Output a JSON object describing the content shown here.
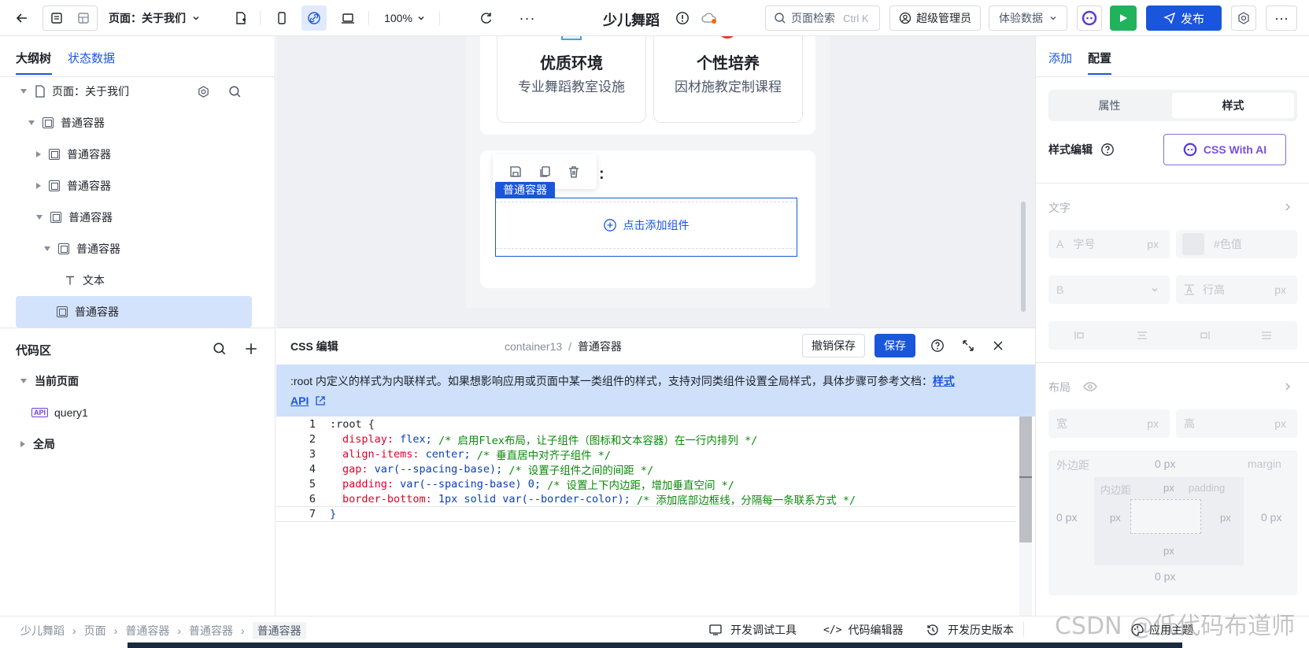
{
  "topbar": {
    "page_selector": "页面：关于我们",
    "zoom": "100%",
    "app_title": "少儿舞蹈",
    "search_placeholder": "页面检索",
    "search_shortcut": "Ctrl K",
    "admin_label": "超级管理员",
    "data_label": "体验数据",
    "publish_label": "发布"
  },
  "left": {
    "tab_outline": "大纲树",
    "tab_state": "状态数据",
    "tree": [
      "页面：关于我们",
      "普通容器",
      "普通容器",
      "普通容器",
      "普通容器",
      "普通容器",
      "文本",
      "普通容器"
    ],
    "code_title": "代码区",
    "current_page": "当前页面",
    "query_label": "query1",
    "api_tag": "API",
    "global": "全局"
  },
  "canvas": {
    "card1_title": "优质环境",
    "card1_desc": "专业舞蹈教室设施",
    "card2_title": "个性培养",
    "card2_desc": "因材施教定制课程",
    "selected_tag": "普通容器",
    "add_component": "点击添加组件"
  },
  "css_editor": {
    "title": "CSS 编辑",
    "path_id": "container13",
    "path_sep": "/",
    "path_name": "普通容器",
    "undo_save": "撤销保存",
    "save": "保存",
    "notice": ":root 内定义的样式为内联样式。如果想影响应用或页面中某一类组件的样式，支持对同类组件设置全局样式，具体步骤可参考文档：",
    "notice_link": "样式",
    "notice_link2": "API",
    "lines": [
      {
        "n": "1",
        "sel": ":root {",
        "prop": "",
        "val": "",
        "com": ""
      },
      {
        "n": "2",
        "sel": "",
        "prop": "display:",
        "val": " flex;",
        "com": " /* 启用Flex布局，让子组件（图标和文本容器）在一行内排列 */"
      },
      {
        "n": "3",
        "sel": "",
        "prop": "align-items:",
        "val": " center;",
        "com": " /* 垂直居中对齐子组件 */"
      },
      {
        "n": "4",
        "sel": "",
        "prop": "gap:",
        "val": " var(--spacing-base);",
        "com": " /* 设置子组件之间的间距 */"
      },
      {
        "n": "5",
        "sel": "",
        "prop": "padding:",
        "val": " var(--spacing-base) 0;",
        "com": " /* 设置上下内边距，增加垂直空间 */"
      },
      {
        "n": "6",
        "sel": "",
        "prop": "border-bottom:",
        "val": " 1px solid var(--border-color);",
        "com": " /* 添加底部边框线，分隔每一条联系方式 */"
      },
      {
        "n": "7",
        "sel": "}",
        "prop": "",
        "val": "",
        "com": ""
      }
    ]
  },
  "right": {
    "tab_add": "添加",
    "tab_config": "配置",
    "seg_props": "属性",
    "seg_style": "样式",
    "style_edit": "样式编辑",
    "css_ai": "CSS With AI",
    "section_text": "文字",
    "font_size_ph": "字号",
    "px": "px",
    "color_ph": "#色值",
    "line_height_ph": "行高",
    "section_layout": "布局",
    "width": "宽",
    "height": "高",
    "margin_label": "外边距",
    "margin_en": "margin",
    "padding_label": "内边距",
    "padding_en": "padding",
    "zero_px": "0 px"
  },
  "bottom": {
    "crumbs": [
      "少儿舞蹈",
      "页面",
      "普通容器",
      "普通容器",
      "普通容器"
    ],
    "dev_tools": "开发调试工具",
    "code_editor": "代码编辑器",
    "history": "开发历史版本",
    "theme": "应用主题"
  },
  "watermark": "CSDN @低代码布道师",
  "colors": {
    "primary": "#1a56db",
    "green": "#21b35c",
    "notice_bg": "#cfe0fb",
    "selected_bg": "#d4e3fc"
  }
}
